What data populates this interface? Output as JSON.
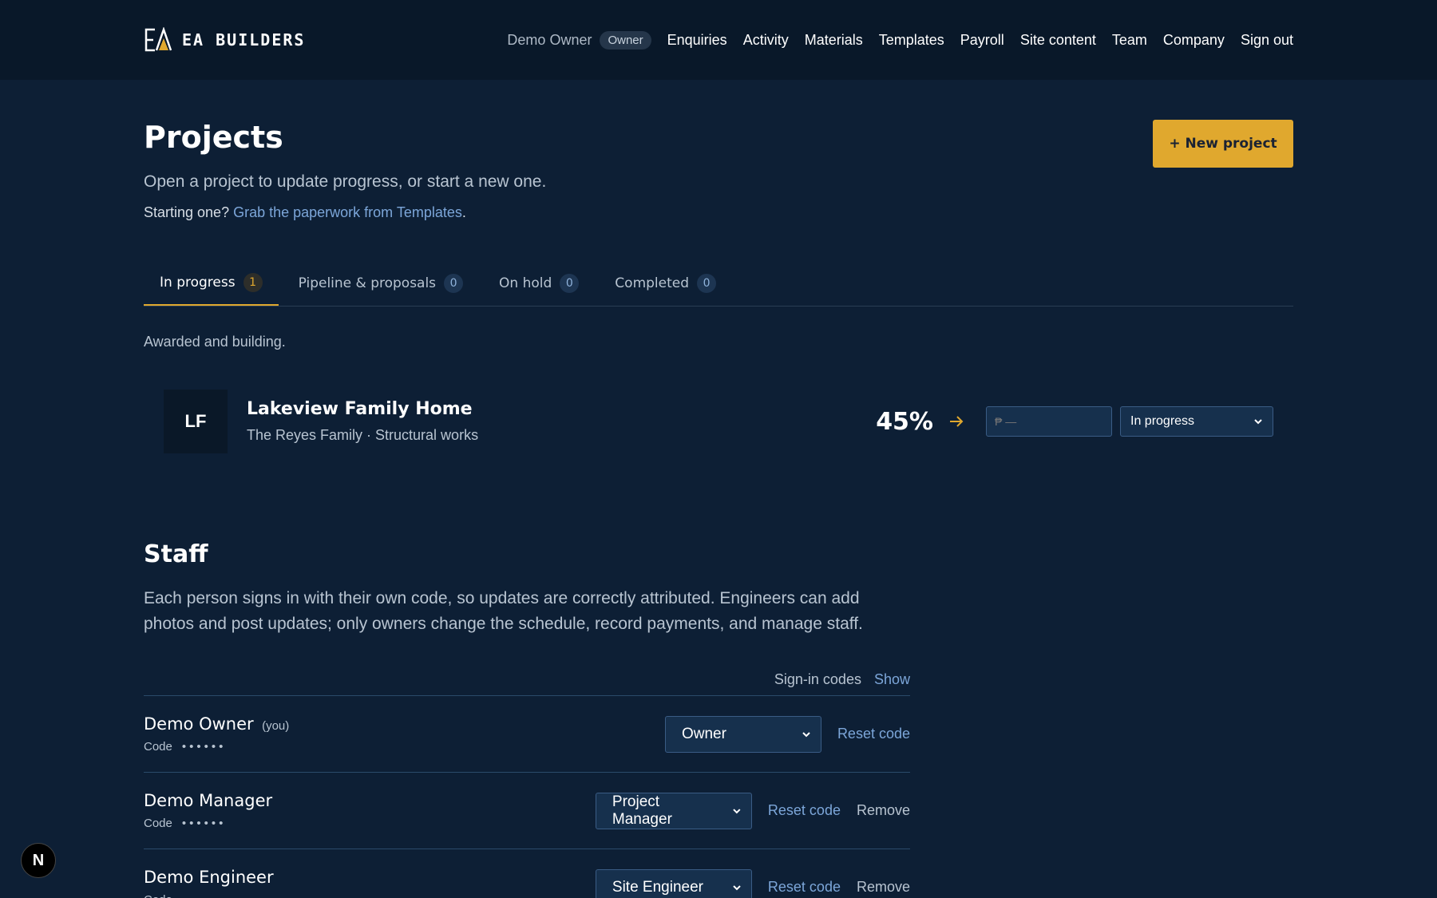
{
  "header": {
    "brand": "EA BUILDERS",
    "user_name": "Demo Owner",
    "user_role": "Owner",
    "nav": [
      "Enquiries",
      "Activity",
      "Materials",
      "Templates",
      "Payroll",
      "Site content",
      "Team",
      "Company"
    ],
    "sign_out": "Sign out"
  },
  "page": {
    "title": "Projects",
    "subtitle": "Open a project to update progress, or start a new one.",
    "tip_prefix": "Starting one?",
    "tip_link": "Grab the paperwork from Templates",
    "tip_suffix": ".",
    "new_button": "+ New project"
  },
  "tabs": [
    {
      "label": "In progress",
      "count": "1"
    },
    {
      "label": "Pipeline & proposals",
      "count": "0"
    },
    {
      "label": "On hold",
      "count": "0"
    },
    {
      "label": "Completed",
      "count": "0"
    }
  ],
  "tab_description": "Awarded and building.",
  "projects": [
    {
      "initials": "LF",
      "name": "Lakeview Family Home",
      "meta": "The Reyes Family · Structural works",
      "progress": "45%",
      "amount_placeholder": "₱ —",
      "status": "In progress"
    }
  ],
  "staff": {
    "title": "Staff",
    "description": "Each person signs in with their own code, so updates are correctly attributed. Engineers can add photos and post updates; only owners change the schedule, record payments, and manage staff.",
    "codes_label": "Sign-in codes",
    "codes_toggle": "Show",
    "code_label": "Code",
    "code_mask": "••••••",
    "members": [
      {
        "name": "Demo Owner",
        "you": "(you)",
        "role": "Owner",
        "reset": "Reset code",
        "remove": ""
      },
      {
        "name": "Demo Manager",
        "you": "",
        "role": "Project Manager",
        "reset": "Reset code",
        "remove": "Remove"
      },
      {
        "name": "Demo Engineer",
        "you": "",
        "role": "Site Engineer",
        "reset": "Reset code",
        "remove": "Remove"
      }
    ]
  },
  "dev_badge": "N",
  "colors": {
    "background": "#0d1f35",
    "header": "#091829",
    "accent": "#e0a82e",
    "link": "#7ca6d9"
  }
}
